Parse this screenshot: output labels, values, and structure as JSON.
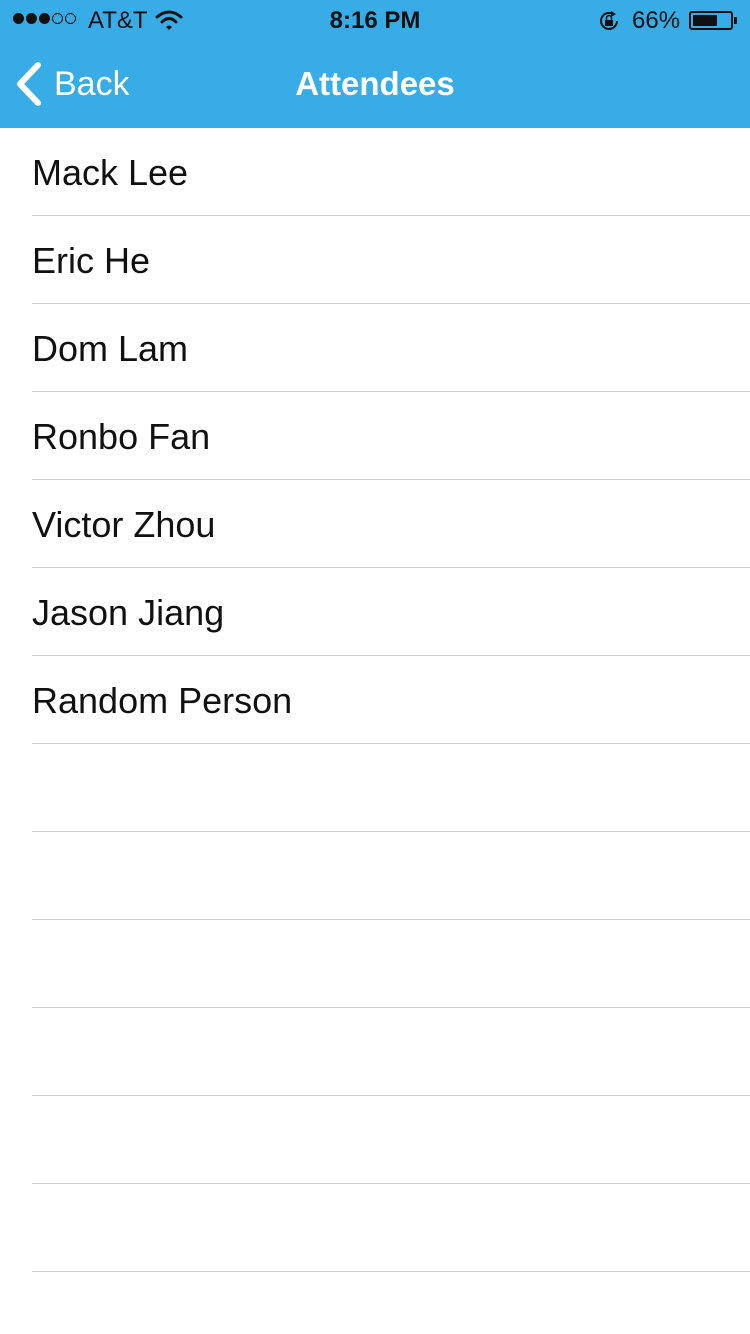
{
  "status_bar": {
    "signal_bars_filled": 3,
    "signal_bars_total": 5,
    "carrier": "AT&T",
    "time": "8:16 PM",
    "battery_percent": "66%",
    "battery_level": 0.66,
    "icons": [
      "signal-dots",
      "wifi-icon",
      "rotation-lock-icon",
      "battery-icon"
    ]
  },
  "nav": {
    "back_label": "Back",
    "title": "Attendees",
    "color": "#38ace6"
  },
  "attendees": [
    "Mack Lee",
    "Eric He",
    "Dom Lam",
    "Ronbo Fan",
    "Victor Zhou",
    "Jason Jiang",
    "Random Person"
  ],
  "empty_rows": 6
}
